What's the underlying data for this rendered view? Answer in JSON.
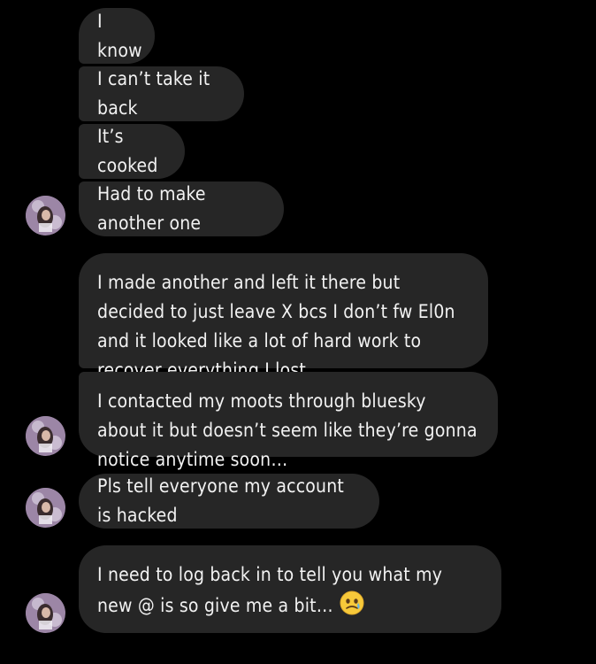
{
  "messages": [
    {
      "text": "I know"
    },
    {
      "text": "I can’t take it back"
    },
    {
      "text": "It’s cooked"
    },
    {
      "text": "Had to make another one"
    },
    {
      "text": "I made another and left it there but decided to just leave X bcs I don’t fw El0n and it looked like a lot of hard work to recover everything I lost"
    },
    {
      "text": "I contacted my moots through bluesky about it but doesn’t seem like they’re gonna notice anytime soon…"
    },
    {
      "text": "Pls tell everyone my account is hacked"
    },
    {
      "text": "I need to log back in to tell you what my new @ is so give me a bit…"
    }
  ],
  "last_message_emoji": "face-holding-back-tears-emoji",
  "colors": {
    "background": "#000000",
    "bubble": "#262626",
    "text": "#f2f2f2"
  }
}
